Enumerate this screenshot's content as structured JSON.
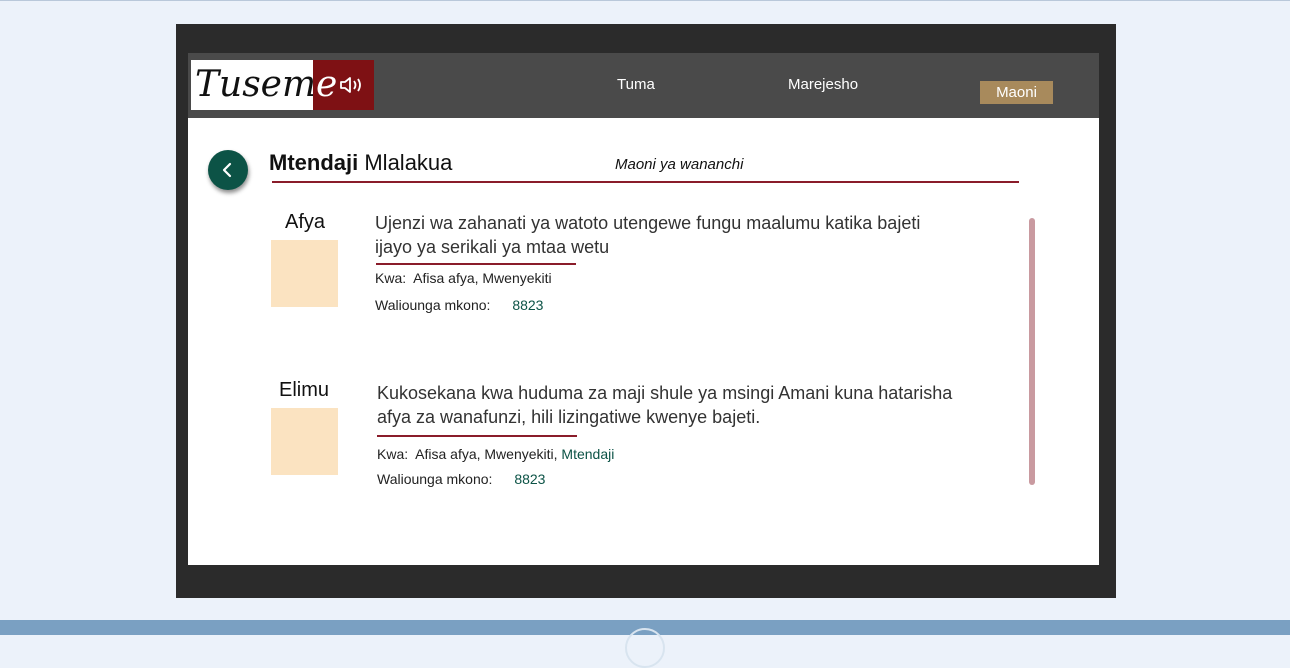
{
  "logo": {
    "text_main": "Tusem",
    "text_red": "e"
  },
  "nav": {
    "items": [
      {
        "label": "Tuma"
      },
      {
        "label": "Marejesho"
      },
      {
        "label": "Maoni"
      }
    ],
    "active": "Maoni"
  },
  "page": {
    "title_bold": "Mtendaji",
    "title_rest": "Mlalakua",
    "subtitle": "Maoni ya wananchi"
  },
  "cards": [
    {
      "category": "Afya",
      "text_line1": "Ujenzi wa zahanati ya watoto utengewe fungu maalumu katika bajeti",
      "text_line2": "ijayo ya serikali ya mtaa wetu",
      "kwa_label": "Kwa:",
      "kwa_value": "Afisa afya, Mwenyekiti",
      "kwa_extra": "",
      "support_label": "Waliounga mkono:",
      "support_count": "8823"
    },
    {
      "category": "Elimu",
      "text_line1": "Kukosekana kwa huduma za maji shule ya msingi Amani kuna hatarisha",
      "text_line2": "afya za wanafunzi, hili lizingatiwe kwenye bajeti.",
      "kwa_label": "Kwa:",
      "kwa_value": "Afisa afya, Mwenyekiti,",
      "kwa_extra": "Mtendaji",
      "support_label": "Waliounga mkono:",
      "support_count": "8823"
    }
  ],
  "colors": {
    "accent_red": "#7e1114",
    "teal": "#0c5346",
    "nav_active": "#a88a5c",
    "card_box": "#fbe3c1"
  }
}
